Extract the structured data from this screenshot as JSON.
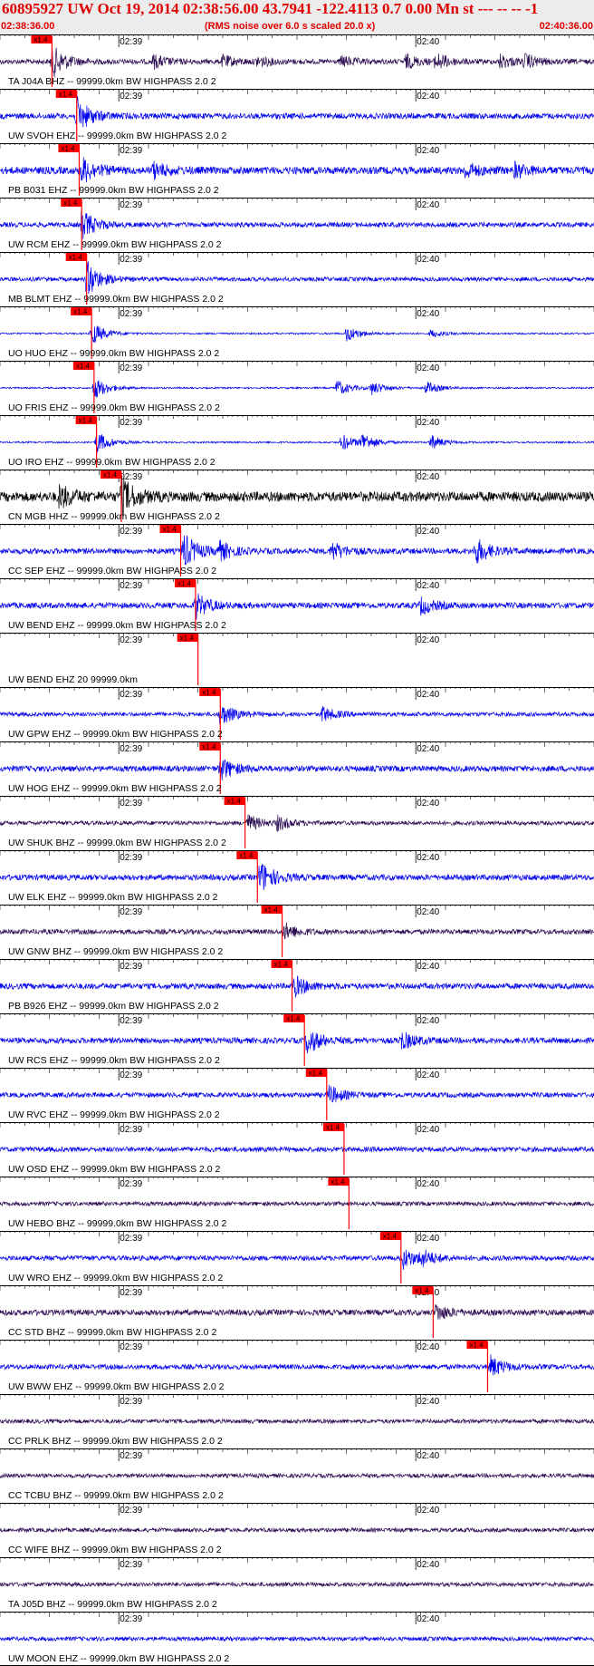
{
  "header": {
    "title": "60895927 UW Oct 19, 2014 02:38:56.00   43.7941 -122.4113  0.7 0.00 Mn st --- -- --  -1",
    "start_time": "02:38:36.00",
    "note": "(RMS noise over 6.0 s scaled 20.0 x)",
    "end_time": "02:40:36.00"
  },
  "chart_data": {
    "type": "line",
    "title": "60895927 UW Oct 19, 2014 02:38:56.00   43.7941 -122.4113  0.7 0.00 Mn st --- -- --  -1",
    "x_range_seconds": [
      0,
      120
    ],
    "time_labels": [
      {
        "t": 24,
        "label": "02:39"
      },
      {
        "t": 84,
        "label": "02:40"
      }
    ],
    "pick_label": "x1.4",
    "colors": {
      "blue": "#0000ee",
      "black": "#000000",
      "purple": "#2a0a50",
      "pick": "#ff0000"
    },
    "traces": [
      {
        "label": "TA J04A BHZ -- 99999.0km BW  HIGHPASS  2.0  2",
        "color": "purple",
        "pick": 10.5,
        "amp": 0.3,
        "bursts": [
          [
            10.5,
            2.0
          ],
          [
            31,
            0.8
          ],
          [
            45,
            0.7
          ],
          [
            52,
            0.6
          ],
          [
            69,
            0.6
          ],
          [
            82,
            0.8
          ],
          [
            88,
            1.0
          ],
          [
            101,
            0.8
          ],
          [
            106,
            0.8
          ]
        ]
      },
      {
        "label": "UW SVOH EHZ -- 99999.0km BW  HIGHPASS  2.0  2",
        "color": "blue",
        "pick": 15.5,
        "amp": 0.35,
        "bursts": [
          [
            15.5,
            2.2
          ]
        ]
      },
      {
        "label": "PB B031 EHZ -- 99999.0km BW  HIGHPASS  2.0  2",
        "color": "blue",
        "pick": 16.0,
        "amp": 0.45,
        "bursts": [
          [
            16.5,
            1.6
          ],
          [
            31,
            0.9
          ],
          [
            94,
            0.9
          ],
          [
            104,
            0.8
          ]
        ]
      },
      {
        "label": "UW RCM EHZ -- 99999.0km BW  HIGHPASS  2.0  2",
        "color": "blue",
        "pick": 16.5,
        "amp": 0.3,
        "bursts": [
          [
            16.5,
            1.8
          ]
        ]
      },
      {
        "label": "MB BLMT EHZ -- 99999.0km BW  HIGHPASS  2.0  2",
        "color": "blue",
        "pick": 17.5,
        "amp": 0.25,
        "bursts": [
          [
            17.5,
            2.2
          ]
        ]
      },
      {
        "label": "UO HUO EHZ -- 99999.0km BW  HIGHPASS  2.0  2",
        "color": "blue",
        "pick": 18.5,
        "amp": 0.1,
        "bursts": [
          [
            18.5,
            1.5
          ],
          [
            70,
            1.0
          ],
          [
            87,
            0.5
          ]
        ]
      },
      {
        "label": "UO FRIS EHZ -- 99999.0km BW  HIGHPASS  2.0  2",
        "color": "blue",
        "pick": 19.0,
        "amp": 0.1,
        "bursts": [
          [
            19,
            1.4
          ],
          [
            68,
            1.0
          ],
          [
            75,
            0.8
          ],
          [
            86,
            0.8
          ]
        ]
      },
      {
        "label": "UO IRO EHZ -- 99999.0km BW  HIGHPASS  2.0  2",
        "color": "blue",
        "pick": 19.5,
        "amp": 0.1,
        "bursts": [
          [
            19.5,
            1.4
          ],
          [
            69,
            1.1
          ],
          [
            73,
            1.1
          ],
          [
            87,
            0.9
          ]
        ]
      },
      {
        "label": "CN MGB HHZ -- 99999.0km BW  HIGHPASS  2.0  2",
        "color": "black",
        "pick": 24.5,
        "amp": 0.6,
        "bursts": [
          [
            12,
            1.3
          ],
          [
            24.5,
            2.2
          ]
        ]
      },
      {
        "label": "CC SEP EHZ -- 99999.0km BW  HIGHPASS  2.0  2",
        "color": "blue",
        "pick": 36.5,
        "amp": 0.35,
        "bursts": [
          [
            37,
            2.2
          ],
          [
            44,
            1.2
          ],
          [
            67,
            1.1
          ],
          [
            96,
            1.6
          ]
        ]
      },
      {
        "label": "UW BEND EHZ -- 99999.0km BW  HIGHPASS  2.0  2",
        "color": "blue",
        "pick": 39.5,
        "amp": 0.35,
        "bursts": [
          [
            39.5,
            1.5
          ],
          [
            85,
            1.0
          ]
        ]
      },
      {
        "label": "UW BEND EHZ 20 99999.0km",
        "color": "blue",
        "pick": 40.0,
        "amp": 0.0,
        "bursts": []
      },
      {
        "label": "UW GPW EHZ -- 99999.0km BW  HIGHPASS  2.0  2",
        "color": "blue",
        "pick": 44.5,
        "amp": 0.25,
        "bursts": [
          [
            44.5,
            1.4
          ],
          [
            65,
            0.9
          ]
        ]
      },
      {
        "label": "UW HOG EHZ -- 99999.0km BW  HIGHPASS  2.0  2",
        "color": "blue",
        "pick": 44.5,
        "amp": 0.35,
        "bursts": [
          [
            44.5,
            1.4
          ]
        ]
      },
      {
        "label": "UW SHUK BHZ -- 99999.0km BW  HIGHPASS  2.0  2",
        "color": "purple",
        "pick": 49.5,
        "amp": 0.25,
        "bursts": [
          [
            50,
            1.0
          ],
          [
            56,
            0.8
          ]
        ]
      },
      {
        "label": "UW ELK EHZ -- 99999.0km BW  HIGHPASS  2.0  2",
        "color": "blue",
        "pick": 52.0,
        "amp": 0.35,
        "bursts": [
          [
            52.5,
            2.0
          ]
        ]
      },
      {
        "label": "UW GNW BHZ -- 99999.0km BW  HIGHPASS  2.0  2",
        "color": "purple",
        "pick": 57.0,
        "amp": 0.3,
        "bursts": [
          [
            57.5,
            1.0
          ]
        ]
      },
      {
        "label": "PB B926 EHZ -- 99999.0km BW  HIGHPASS  2.0  2",
        "color": "blue",
        "pick": 59.0,
        "amp": 0.35,
        "bursts": [
          [
            59.5,
            1.2
          ]
        ]
      },
      {
        "label": "UW RCS EHZ -- 99999.0km BW  HIGHPASS  2.0  2",
        "color": "blue",
        "pick": 61.5,
        "amp": 0.35,
        "bursts": [
          [
            62,
            1.6
          ],
          [
            81,
            1.1
          ]
        ]
      },
      {
        "label": "UW RVC EHZ -- 99999.0km BW  HIGHPASS  2.0  2",
        "color": "blue",
        "pick": 66.0,
        "amp": 0.3,
        "bursts": [
          [
            66.5,
            1.1
          ]
        ]
      },
      {
        "label": "UW OSD EHZ -- 99999.0km BW  HIGHPASS  2.0  2",
        "color": "blue",
        "pick": 69.5,
        "amp": 0.3,
        "bursts": []
      },
      {
        "label": "UW HEBO BHZ -- 99999.0km BW  HIGHPASS  2.0  2",
        "color": "purple",
        "pick": 70.5,
        "amp": 0.25,
        "bursts": []
      },
      {
        "label": "UW WRO EHZ -- 99999.0km BW  HIGHPASS  2.0  2",
        "color": "blue",
        "pick": 81.0,
        "amp": 0.3,
        "bursts": [
          [
            81.5,
            1.2
          ],
          [
            85,
            0.9
          ]
        ]
      },
      {
        "label": "CC STD BHZ -- 99999.0km BW  HIGHPASS  2.0  2",
        "color": "purple",
        "pick": 87.5,
        "amp": 0.35,
        "bursts": [
          [
            88,
            1.0
          ]
        ]
      },
      {
        "label": "UW BWW EHZ -- 99999.0km BW  HIGHPASS  2.0  2",
        "color": "blue",
        "pick": 98.5,
        "amp": 0.3,
        "bursts": [
          [
            99,
            1.3
          ]
        ]
      },
      {
        "label": "CC PRLK BHZ -- 99999.0km BW  HIGHPASS  2.0  2",
        "color": "purple",
        "pick": null,
        "amp": 0.25,
        "bursts": []
      },
      {
        "label": "CC TCBU BHZ -- 99999.0km BW  HIGHPASS  2.0  2",
        "color": "purple",
        "pick": null,
        "amp": 0.25,
        "bursts": []
      },
      {
        "label": "CC WIFE BHZ -- 99999.0km BW  HIGHPASS  2.0  2",
        "color": "purple",
        "pick": null,
        "amp": 0.25,
        "bursts": []
      },
      {
        "label": "TA J05D BHZ -- 99999.0km BW  HIGHPASS  2.0  2",
        "color": "purple",
        "pick": null,
        "amp": 0.25,
        "bursts": []
      },
      {
        "label": "UW MOON EHZ -- 99999.0km BW  HIGHPASS  2.0  2",
        "color": "blue",
        "pick": null,
        "amp": 0.25,
        "bursts": []
      }
    ]
  }
}
